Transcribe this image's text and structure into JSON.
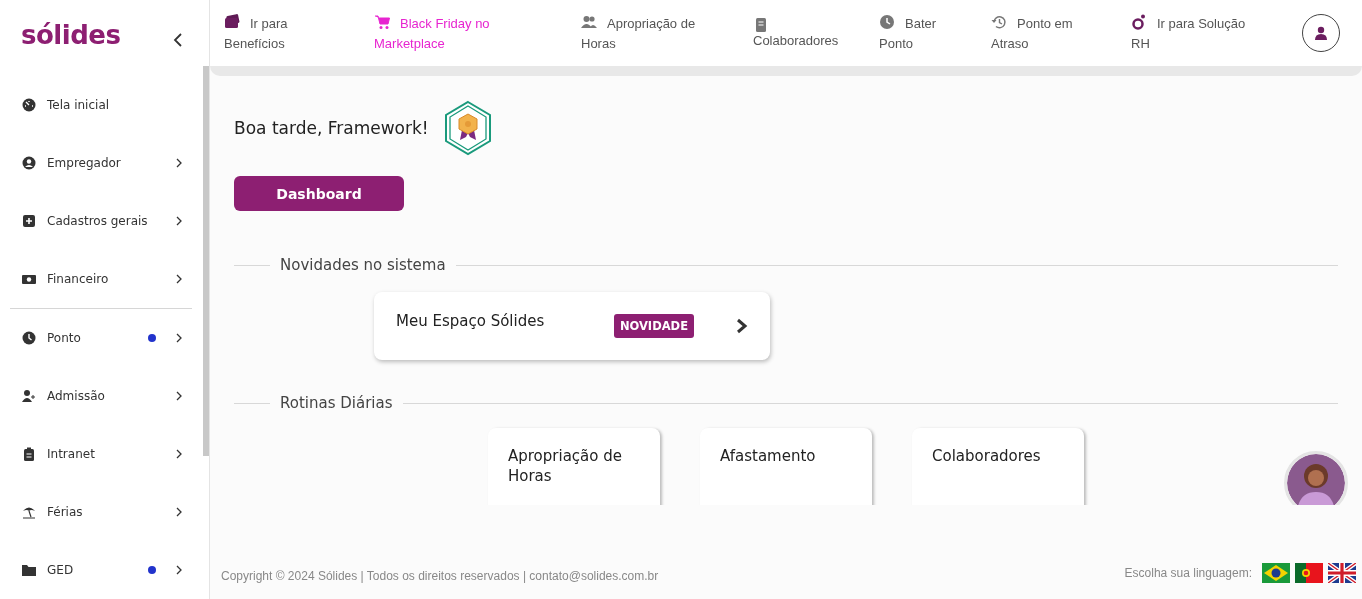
{
  "logo": "sólides",
  "sidebar": {
    "groups": [
      [
        {
          "label": "Tela inicial",
          "dot": false,
          "expandable": false
        },
        {
          "label": "Empregador",
          "dot": false,
          "expandable": true
        },
        {
          "label": "Cadastros gerais",
          "dot": false,
          "expandable": true
        },
        {
          "label": "Financeiro",
          "dot": false,
          "expandable": true
        }
      ],
      [
        {
          "label": "Ponto",
          "dot": true,
          "expandable": true
        },
        {
          "label": "Admissão",
          "dot": false,
          "expandable": true
        },
        {
          "label": "Intranet",
          "dot": false,
          "expandable": true
        },
        {
          "label": "Férias",
          "dot": false,
          "expandable": true
        },
        {
          "label": "GED",
          "dot": true,
          "expandable": true
        }
      ]
    ]
  },
  "topnav": [
    {
      "label": "Ir para Benefícios",
      "highlight": false
    },
    {
      "label": "Black Friday no Marketplace",
      "highlight": true
    },
    {
      "label": "Apropriação de Horas",
      "highlight": false
    },
    {
      "label": "Colaboradores",
      "highlight": false
    },
    {
      "label": "Bater Ponto",
      "highlight": false
    },
    {
      "label": "Ponto em Atraso",
      "highlight": false
    },
    {
      "label": "Ir para Solução RH",
      "highlight": false
    }
  ],
  "greeting": "Boa tarde, Framework!",
  "dashboard_button": "Dashboard",
  "sections": [
    {
      "title": "Novidades no sistema",
      "kind": "news",
      "cards": [
        {
          "title": "Meu Espaço Sólides",
          "badge": "NOVIDADE"
        }
      ]
    },
    {
      "title": "Rotinas Diárias",
      "kind": "routines",
      "cards": [
        {
          "title": "Apropriação de Horas"
        },
        {
          "title": "Afastamento"
        },
        {
          "title": "Colaboradores"
        }
      ]
    }
  ],
  "footer": {
    "copyright": "Copyright © 2024 Sólides | Todos os direitos reservados | contato@solides.com.br",
    "language_label": "Escolha sua linguagem:"
  }
}
